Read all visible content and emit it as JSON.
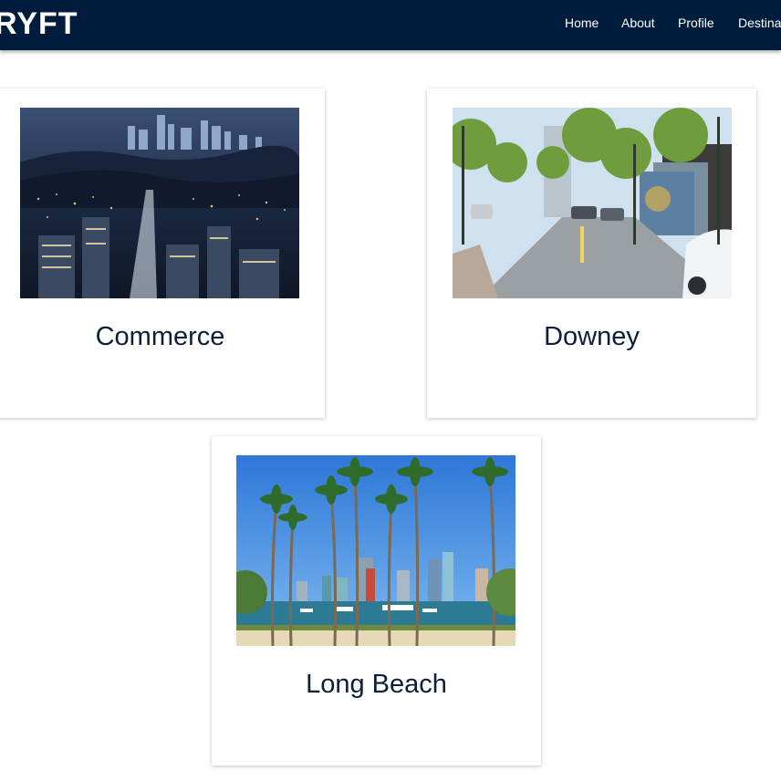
{
  "nav": {
    "brand": "RYFT",
    "links": [
      "Home",
      "About",
      "Profile",
      "Destinat"
    ]
  },
  "cards": [
    {
      "title": "Commerce",
      "image": "city-night-skyline-photo"
    },
    {
      "title": "Downey",
      "image": "street-scene-photo"
    },
    {
      "title": "Long Beach",
      "image": "palm-trees-skyline-photo"
    }
  ]
}
